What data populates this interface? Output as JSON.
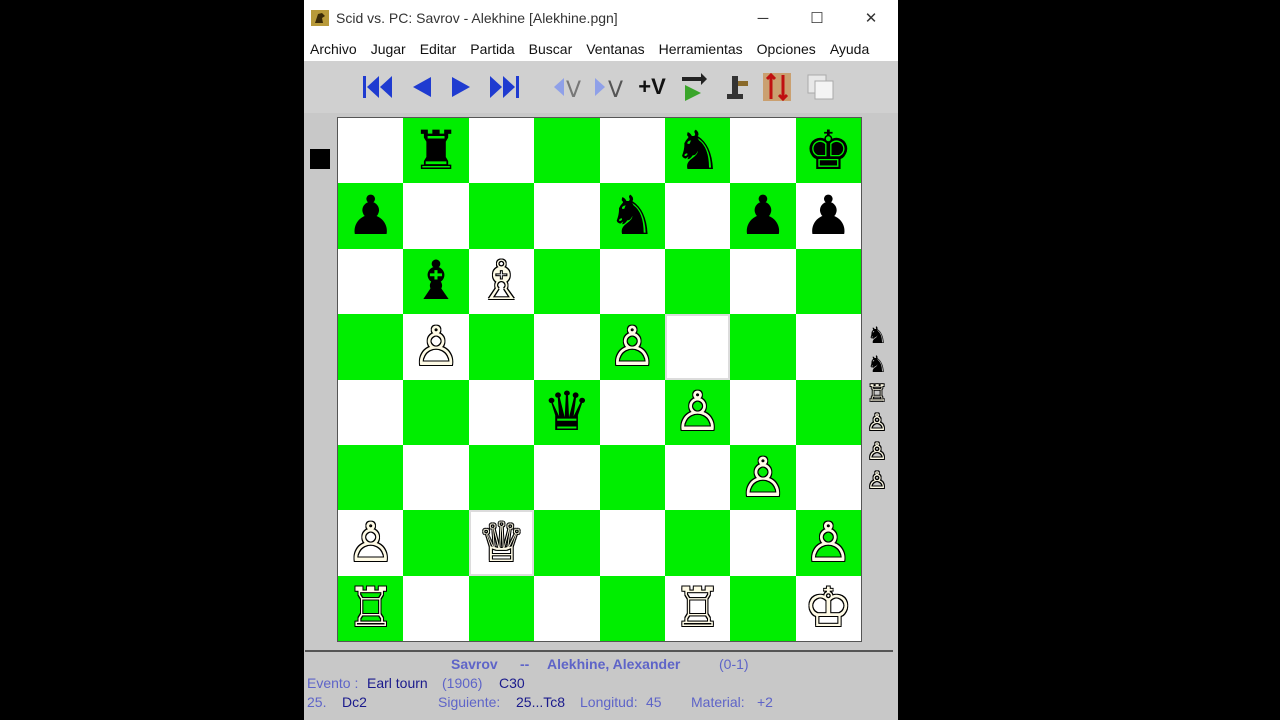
{
  "window": {
    "title": "Scid vs. PC: Savrov - Alekhine [Alekhine.pgn]",
    "controls": {
      "minimize": "─",
      "maximize": "☐",
      "close": "✕"
    }
  },
  "menu": [
    "Archivo",
    "Jugar",
    "Editar",
    "Partida",
    "Buscar",
    "Ventanas",
    "Herramientas",
    "Opciones",
    "Ayuda"
  ],
  "toolbar": {
    "icons": [
      "goto-start-icon",
      "back-icon",
      "forward-icon",
      "goto-end-icon",
      "exit-variation-icon",
      "enter-variation-icon",
      "add-variation-icon",
      "autoplay-icon",
      "engine-icon",
      "flip-board-icon",
      "copy-icon"
    ],
    "add_variation_label": "+V",
    "variation_letter": "V"
  },
  "colors": {
    "light_square": "#ffffff",
    "dark_square": "#00ee00",
    "info_blue": "#5e64c8",
    "info_navy": "#1a1a8c"
  },
  "board": {
    "side_to_move": "black",
    "ranks": [
      [
        "",
        "♜",
        "",
        "",
        "",
        "♞",
        "",
        "♚"
      ],
      [
        "♟",
        "",
        "",
        "",
        "♞",
        "",
        "♟",
        "♟"
      ],
      [
        "",
        "♝",
        "♗",
        "",
        "",
        "",
        "",
        ""
      ],
      [
        "",
        "♙",
        "",
        "",
        "♙",
        "",
        "",
        ""
      ],
      [
        "",
        "",
        "",
        "♛",
        "",
        "♙",
        "",
        ""
      ],
      [
        "",
        "",
        "",
        "",
        "",
        "",
        "♙",
        ""
      ],
      [
        "♙",
        "",
        "♕",
        "",
        "",
        "",
        "",
        "♙"
      ],
      [
        "♖",
        "",
        "",
        "",
        "",
        "♖",
        "",
        "♔"
      ]
    ],
    "highlighted": [
      "f5",
      "c2"
    ]
  },
  "captured": [
    "♞",
    "♞",
    "♖",
    "♙",
    "♙",
    "♙"
  ],
  "info": {
    "white_player": "Savrov",
    "separator": "--",
    "black_player": "Alekhine, Alexander",
    "result": "(0-1)",
    "event_label": "Evento :",
    "event": "Earl tourn",
    "year": "(1906)",
    "eco": "C30",
    "move_number": "25.",
    "last_move": "Dc2",
    "next_label": "Siguiente:",
    "next_move": "25...Tc8",
    "length_label": "Longitud:",
    "length": "45",
    "material_label": "Material:",
    "material": "+2"
  }
}
